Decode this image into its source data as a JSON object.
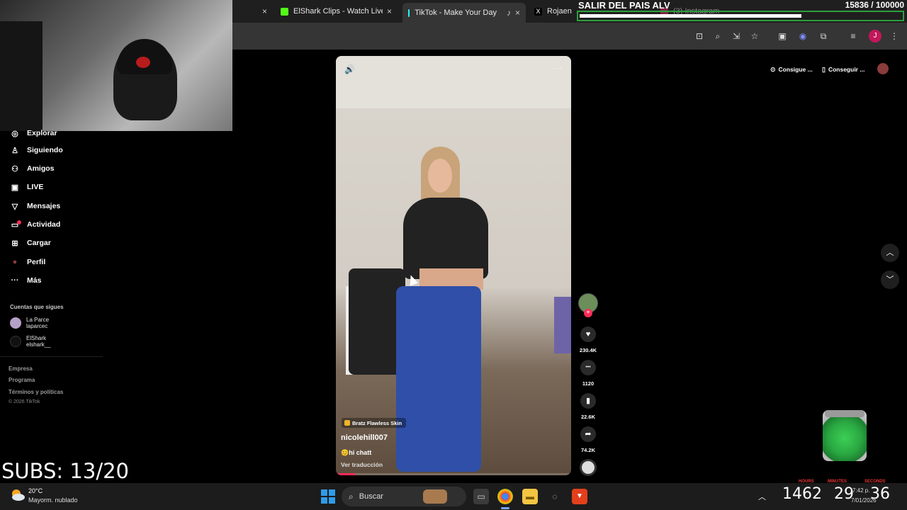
{
  "browser": {
    "tabs": [
      {
        "title": "",
        "icon": "blank-icon",
        "active": false
      },
      {
        "title": "ElShark Clips - Watch Live or",
        "icon": "kick-icon",
        "active": false
      },
      {
        "title": "TikTok - Make Your Day",
        "icon": "tiktok-icon",
        "active": true
      },
      {
        "title": "Rojaen",
        "icon": "x-icon",
        "active": false
      },
      {
        "title": "(3) Instagram",
        "icon": "instagram-icon",
        "active": false
      }
    ],
    "close_glyph": "×",
    "profile_initial": "J"
  },
  "goal": {
    "title": "SALIR DEL PAIS ALV",
    "count": "15836 / 100000",
    "current": 15836,
    "target": 100000,
    "bar_color": "#2e9e3e"
  },
  "sidebar": {
    "items": [
      {
        "label": "Explorar",
        "icon": "compass-icon",
        "glyph": "◎"
      },
      {
        "label": "Siguiendo",
        "icon": "following-icon",
        "glyph": "♙"
      },
      {
        "label": "Amigos",
        "icon": "friends-icon",
        "glyph": "⚇"
      },
      {
        "label": "LIVE",
        "icon": "live-icon",
        "glyph": "▣"
      },
      {
        "label": "Mensajes",
        "icon": "messages-icon",
        "glyph": "▽"
      },
      {
        "label": "Actividad",
        "icon": "activity-icon",
        "glyph": "▭"
      },
      {
        "label": "Cargar",
        "icon": "upload-icon",
        "glyph": "⊞"
      },
      {
        "label": "Perfil",
        "icon": "profile-icon",
        "glyph": "●"
      },
      {
        "label": "Más",
        "icon": "more-icon",
        "glyph": "···"
      }
    ],
    "following_title": "Cuentas que sigues",
    "following": [
      {
        "name": "La Parce",
        "handle": "laparcec"
      },
      {
        "name": "ElShark",
        "handle": "elshark__"
      }
    ],
    "footer_links": [
      "Empresa",
      "Programa",
      "Términos y políticas"
    ],
    "copyright": "© 2026 TikTok"
  },
  "video": {
    "effect_label": "Bratz Flawless Skin",
    "author": "nicolehill007",
    "caption": "😊hi chatt",
    "translate_label": "Ver traducción",
    "mute_glyph": "🔊",
    "more_glyph": "···",
    "progress": 0.08,
    "progress_color": "#fe2c55"
  },
  "actions": {
    "like_count": "230.4K",
    "comment_count": "1120",
    "save_count": "22.6K",
    "share_count": "74.2K",
    "like_glyph": "♥",
    "comment_glyph": "•••",
    "save_glyph": "▮",
    "share_glyph": "➦",
    "follow_glyph": "+"
  },
  "top_right": {
    "pill1": "Consigue ...",
    "pill2": "Conseguir ...",
    "up_glyph": "︿",
    "down_glyph": "﹀"
  },
  "overlay": {
    "subs": "SUBS: 13/20"
  },
  "taskbar": {
    "temp": "20°C",
    "weather": "Mayorm. nublado",
    "search_label": "Buscar",
    "timer_hours": "1462",
    "timer_minutes": "29",
    "timer_seconds": "36",
    "label_hours": "HOURS",
    "label_minutes": "MINUTES",
    "label_seconds": "SECONDS",
    "time": "7:42 p.",
    "date": "7/01/2026"
  }
}
